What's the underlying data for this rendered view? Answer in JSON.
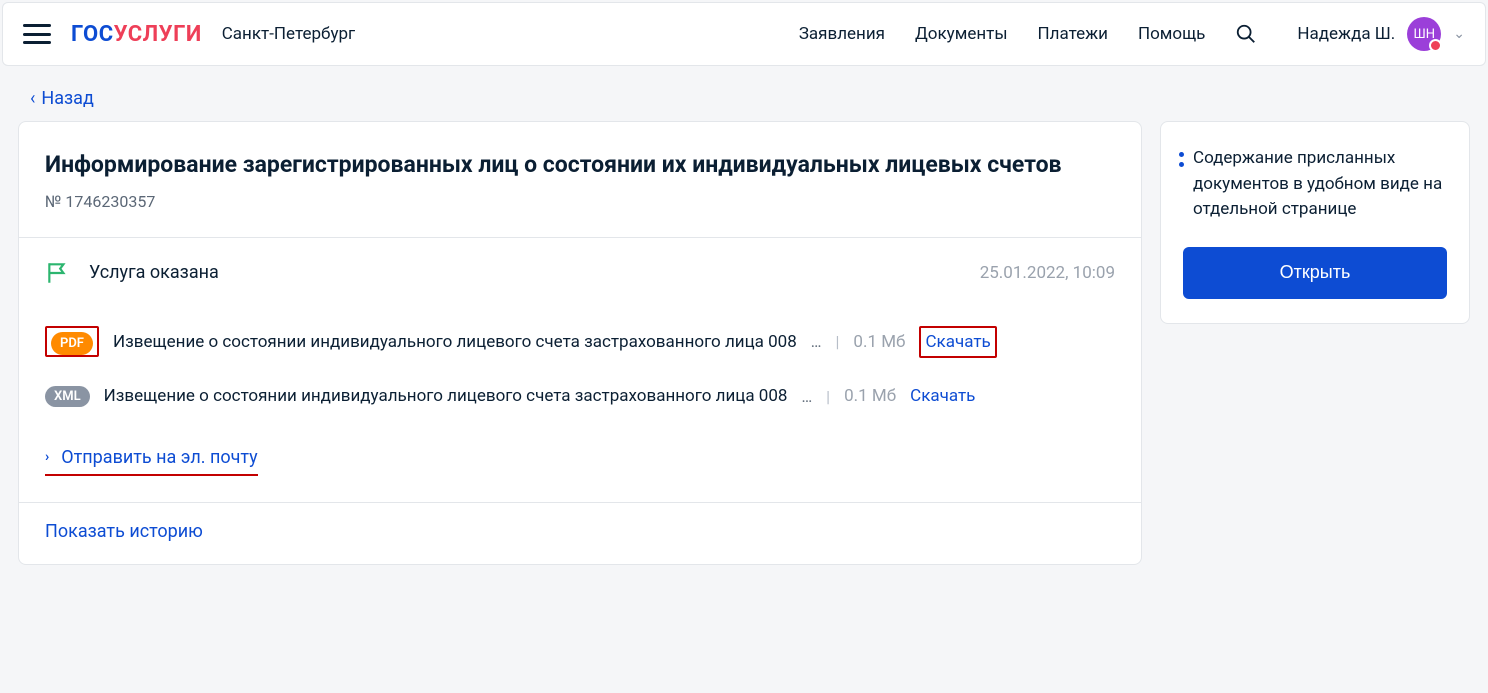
{
  "header": {
    "city": "Санкт-Петербург",
    "nav": {
      "applications": "Заявления",
      "documents": "Документы",
      "payments": "Платежи",
      "help": "Помощь"
    },
    "user_name": "Надежда Ш.",
    "avatar_initials": "ШН"
  },
  "back_label": "Назад",
  "main": {
    "title": "Информирование зарегистрированных лиц о состоянии их индивидуальных лицевых счетов",
    "request_number": "№ 1746230357",
    "status_text": "Услуга оказана",
    "status_date": "25.01.2022, 10:09",
    "files": [
      {
        "badge": "PDF",
        "name": "Извещение о состоянии индивидуального лицевого счета застрахованного лица 008",
        "size": "0.1 Мб",
        "download": "Скачать",
        "highlight": true
      },
      {
        "badge": "XML",
        "name": "Извещение о состоянии индивидуального лицевого счета застрахованного лица 008",
        "size": "0.1 Мб",
        "download": "Скачать",
        "highlight": false
      }
    ],
    "send_email": "Отправить на эл. почту",
    "show_history": "Показать историю"
  },
  "sidebar": {
    "text": "Содержание присланных документов в удобном виде на отдельной странице",
    "open_button": "Открыть"
  }
}
